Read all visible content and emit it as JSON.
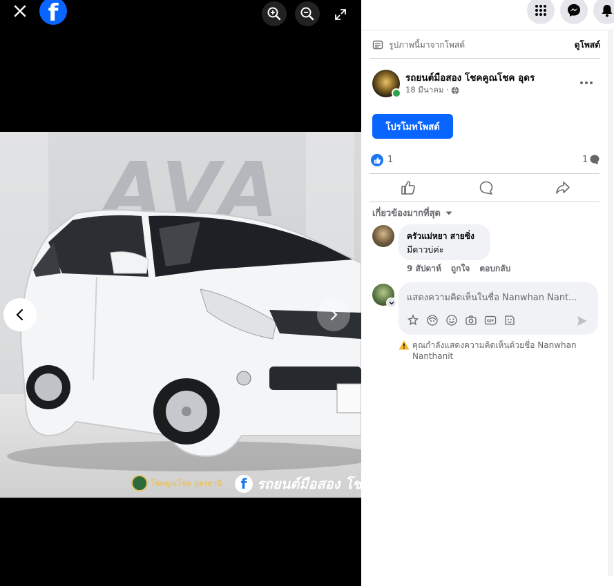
{
  "viewer": {
    "watermark_text": "AVA",
    "overlay_logo_text": "โชคคูณโชค อุดรธานี",
    "overlay_caption": "รถยนต์มือสอง โช"
  },
  "post": {
    "source_note": "รูปภาพนี้มาจากโพสต์",
    "view_post": "ดูโพสต์",
    "page_name": "รถยนต์มือสอง โชคคูณโชค อุดร",
    "date": "18 มีนาคม ·",
    "promote": "โปรโมทโพสต์",
    "like_count": "1",
    "comment_count": "1"
  },
  "comments": {
    "sort_label": "เกี่ยวข้องมากที่สุด",
    "items": [
      {
        "author": "ครัวแม่หยา สายซิ่ง",
        "text": "มีดาวบ่ค่ะ",
        "time": "9 สัปดาห์",
        "like": "ถูกใจ",
        "reply": "ตอบกลับ"
      }
    ],
    "composer_placeholder": "แสดงความคิดเห็นในชื่อ Nanwhan Nant...",
    "warning_line1": "คุณกำลังแสดงความคิดเห็นด้วยชื่อ Nanwhan",
    "warning_line2": "Nanthanit"
  },
  "colors": {
    "fb_blue": "#0866ff",
    "warning_yellow": "#f7b928"
  },
  "icons": [
    "close-icon",
    "facebook-logo-icon",
    "zoom-in-icon",
    "zoom-out-icon",
    "fullscreen-icon",
    "chevron-left-icon",
    "chevron-right-icon",
    "menu-grid-icon",
    "messenger-icon",
    "bell-icon",
    "post-note-icon",
    "globe-icon",
    "more-icon",
    "like-icon",
    "comment-icon",
    "share-icon",
    "caret-down-icon",
    "sticker-icon",
    "avatar-sticker-icon",
    "emoji-icon",
    "camera-icon",
    "gif-icon",
    "sticker-face-icon",
    "send-icon",
    "warning-icon"
  ]
}
